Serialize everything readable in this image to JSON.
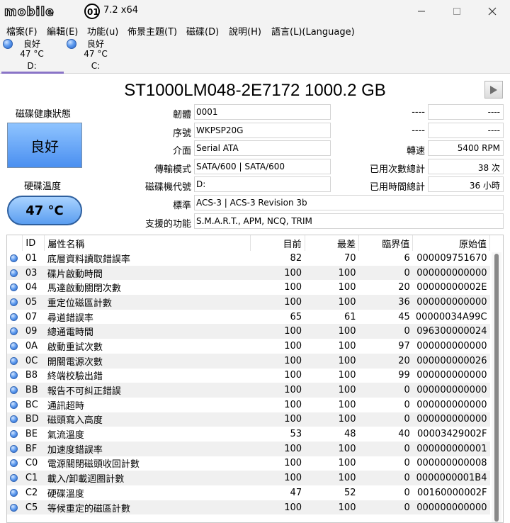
{
  "window": {
    "title_suffix": "7.2 x64",
    "logo_text": "mobile01"
  },
  "menu": [
    {
      "label": "檔案(F)"
    },
    {
      "label": "編輯(E)"
    },
    {
      "label": "功能(u)"
    },
    {
      "label": "佈景主題(T)"
    },
    {
      "label": "磁碟(D)"
    },
    {
      "label": "說明(H)"
    },
    {
      "label": "語言(L)(Language)"
    }
  ],
  "drives": [
    {
      "status": "良好",
      "temp": "47 °C",
      "letter": "D:"
    },
    {
      "status": "良好",
      "temp": "47 °C",
      "letter": "C:"
    }
  ],
  "disk": {
    "title": "ST1000LM048-2E7172 1000.2 GB",
    "health_label": "磁碟健康狀態",
    "health_value": "良好",
    "temp_label": "硬碟溫度",
    "temp_value": "47 °C"
  },
  "fields": {
    "firmware_label": "韌體",
    "firmware": "0001",
    "serial_label": "序號",
    "serial": "WKPSP20G",
    "interface_label": "介面",
    "interface": "Serial ATA",
    "transfer_label": "傳輸模式",
    "transfer": "SATA/600 | SATA/600",
    "letter_label": "磁碟機代號",
    "letter": "D:",
    "standard_label": "標準",
    "standard": "ACS-3 | ACS-3 Revision 3b",
    "features_label": "支援的功能",
    "features": "S.M.A.R.T., APM, NCQ, TRIM",
    "r1_label": "----",
    "r1": "----",
    "r2_label": "----",
    "r2": "----",
    "rpm_label": "轉速",
    "rpm": "5400 RPM",
    "poweron_count_label": "已用次數總計",
    "poweron_count": "38 次",
    "poweron_hours_label": "已用時間總計",
    "poweron_hours": "36 小時"
  },
  "table": {
    "headers": {
      "id": "ID",
      "name": "屬性名稱",
      "current": "目前",
      "worst": "最差",
      "threshold": "臨界值",
      "raw": "原始值"
    },
    "rows": [
      {
        "id": "01",
        "name": "底層資料讀取錯誤率",
        "current": "82",
        "worst": "70",
        "threshold": "6",
        "raw": "000009751670"
      },
      {
        "id": "03",
        "name": "碟片啟動時間",
        "current": "100",
        "worst": "100",
        "threshold": "0",
        "raw": "000000000000"
      },
      {
        "id": "04",
        "name": "馬達啟動關閉次數",
        "current": "100",
        "worst": "100",
        "threshold": "20",
        "raw": "00000000002E"
      },
      {
        "id": "05",
        "name": "重定位磁區計數",
        "current": "100",
        "worst": "100",
        "threshold": "36",
        "raw": "000000000000"
      },
      {
        "id": "07",
        "name": "尋道錯誤率",
        "current": "65",
        "worst": "61",
        "threshold": "45",
        "raw": "00000034A99C"
      },
      {
        "id": "09",
        "name": "總通電時間",
        "current": "100",
        "worst": "100",
        "threshold": "0",
        "raw": "096300000024"
      },
      {
        "id": "0A",
        "name": "啟動重試次數",
        "current": "100",
        "worst": "100",
        "threshold": "97",
        "raw": "000000000000"
      },
      {
        "id": "0C",
        "name": "開關電源次數",
        "current": "100",
        "worst": "100",
        "threshold": "20",
        "raw": "000000000026"
      },
      {
        "id": "B8",
        "name": "終端校驗出錯",
        "current": "100",
        "worst": "100",
        "threshold": "99",
        "raw": "000000000000"
      },
      {
        "id": "BB",
        "name": "報告不可糾正錯誤",
        "current": "100",
        "worst": "100",
        "threshold": "0",
        "raw": "000000000000"
      },
      {
        "id": "BC",
        "name": "通訊超時",
        "current": "100",
        "worst": "100",
        "threshold": "0",
        "raw": "000000000000"
      },
      {
        "id": "BD",
        "name": "磁頭寫入高度",
        "current": "100",
        "worst": "100",
        "threshold": "0",
        "raw": "000000000000"
      },
      {
        "id": "BE",
        "name": "氣流溫度",
        "current": "53",
        "worst": "48",
        "threshold": "40",
        "raw": "00003429002F"
      },
      {
        "id": "BF",
        "name": "加速度錯誤率",
        "current": "100",
        "worst": "100",
        "threshold": "0",
        "raw": "000000000001"
      },
      {
        "id": "C0",
        "name": "電源關閉磁頭收回計數",
        "current": "100",
        "worst": "100",
        "threshold": "0",
        "raw": "000000000008"
      },
      {
        "id": "C1",
        "name": "載入/卸載迴圈計數",
        "current": "100",
        "worst": "100",
        "threshold": "0",
        "raw": "0000000001B4"
      },
      {
        "id": "C2",
        "name": "硬碟溫度",
        "current": "47",
        "worst": "52",
        "threshold": "0",
        "raw": "00160000002F"
      },
      {
        "id": "C5",
        "name": "等候重定的磁區計數",
        "current": "100",
        "worst": "100",
        "threshold": "0",
        "raw": "000000000000"
      }
    ]
  }
}
